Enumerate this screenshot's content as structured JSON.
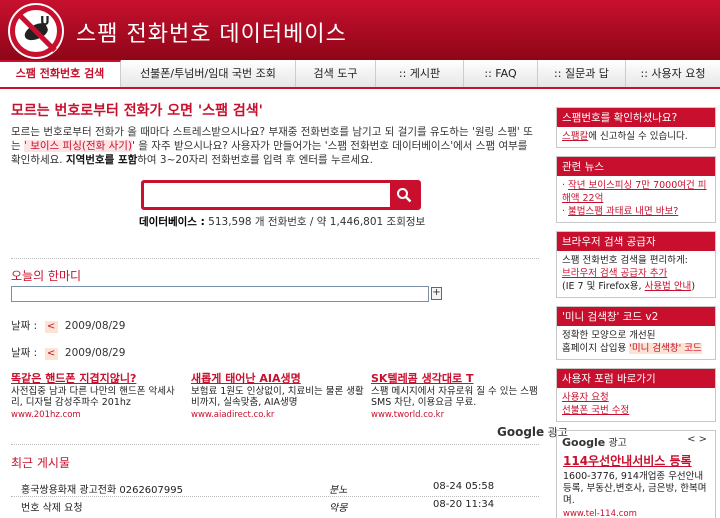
{
  "header": {
    "title": "스팸 전화번호 데이터베이스"
  },
  "nav": [
    "스팸 전화번호 검색",
    "선불폰/투넘버/임대 국번 조회",
    "검색 도구",
    ":: 게시판",
    ":: FAQ",
    ":: 질문과 답",
    ":: 사용자 요청"
  ],
  "main": {
    "title": "모르는 번호로부터 전화가 오면 '스팸 검색'",
    "intro_1": "모르는 번호로부터 전화가 올 때마다 스트레스받으시나요? 부재중 전화번호를 남기고 되 걸기를 유도하는 '원링 스팸' 또는",
    "intro_hl": "' 보이스 피싱(전화 사기)",
    "intro_2": "' 을 자주 받으시나요? 사용자가 만들어가는 '스팸 전화번호 데이터베이스'에서 스팸 여부를 확인하세요.",
    "intro_bold": "지역번호를 포함",
    "intro_3": "하여 3~20자리 전화번호를 입력 후 엔터를 누르세요.",
    "stats_label": "데이터베이스 :",
    "stats_value": "513,598 개 전화번호 / 약 1,446,801 조회정보",
    "today_title": "오늘의 한마디",
    "plus": "+",
    "date_label": "날짜 :",
    "arrow": "<",
    "dates": [
      "2009/08/29",
      "2009/08/29"
    ]
  },
  "ads": [
    {
      "title": "똑같은 핸드폰 지겹지않니?",
      "desc": "사전집중 남과 다른 나만의 핸드폰 악세사리, 디자털 감성주파수 201hz",
      "url": "www.201hz.com"
    },
    {
      "title": "새롭게 태어난 AIA생명",
      "desc": "보험료 1원도 인상없이, 치료비는 물론 생활비까지, 실속맞춤, AIA생명",
      "url": "www.aiadirect.co.kr"
    },
    {
      "title": "SK텔레콤 생각대로 T",
      "desc": "스팸 메시지에서 자유로워 질 수 있는 스팸 SMS 차단, 이용요금 무료.",
      "url": "www.tworld.co.kr"
    }
  ],
  "google_label": {
    "brand": "Google",
    "suffix": "광고"
  },
  "recent": {
    "title": "최근 게시물",
    "rows": [
      {
        "text": "홍국쌍용화재 광고전화 0262607995",
        "tag": "분노",
        "date": "08-24 05:58"
      },
      {
        "text": "번호 삭제 요청",
        "tag": "악몽",
        "date": "08-20 11:34"
      }
    ]
  },
  "sidebar": {
    "box1": {
      "head": "스팸번호를 확인하셨나요?",
      "link": "스팸칼",
      "rest": "에 신고하실 수 있습니다."
    },
    "box2": {
      "head": "관련 뉴스",
      "items": [
        "작년 보이스피싱 7만 7000여건 피해액 22억",
        "불법스팸 과태료 내면 바보?"
      ]
    },
    "box3": {
      "head": "브라우저 검색 공급자",
      "line1": "스팸 전화번호 검색을 편리하게:",
      "link1": "브라우저 검색 공급자 추가",
      "line2": "(IE 7 및 Firefox용, ",
      "link2": "사용법 안내",
      "line2_end": ")"
    },
    "box4": {
      "head": "'미니 검색창' 코드 v2",
      "line1": "정확한 모양으로 개선된",
      "line2": "홈페이지 삽입용 ",
      "hl": "'미니 검색창' 코드"
    },
    "box5": {
      "head": "사용자 포럼 바로가기",
      "links": [
        "사용자 요청",
        "선불폰 국번 수정"
      ]
    },
    "gad": {
      "brand": "Google",
      "suffix": "광고",
      "nav": "< >",
      "title": "114우선안내서비스 등록",
      "desc": "1600-3776, 914개업종 우선안내등록, 부동산,변호사, 금은방, 한복며며.",
      "url": "www.tel-114.com"
    }
  }
}
